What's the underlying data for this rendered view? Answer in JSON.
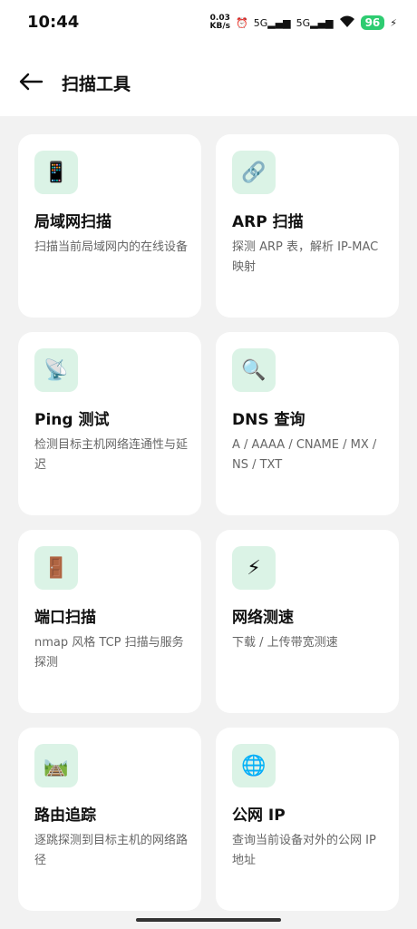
{
  "status_bar": {
    "time": "10:44",
    "net_speed_value": "0.03",
    "net_speed_unit": "KB/s",
    "signal_1": "5G",
    "signal_2": "5G",
    "battery": "96"
  },
  "app_bar": {
    "title": "扫描工具"
  },
  "tools": [
    {
      "icon": "📱",
      "title": "局域网扫描",
      "desc": "扫描当前局域网内的在线设备"
    },
    {
      "icon": "🔗",
      "title": "ARP 扫描",
      "desc": "探测 ARP 表，解析 IP-MAC 映射"
    },
    {
      "icon": "📡",
      "title": "Ping 测试",
      "desc": "检测目标主机网络连通性与延迟"
    },
    {
      "icon": "🔍",
      "title": "DNS 查询",
      "desc": "A / AAAA / CNAME / MX / NS / TXT"
    },
    {
      "icon": "🚪",
      "title": "端口扫描",
      "desc": "nmap 风格 TCP 扫描与服务探测"
    },
    {
      "icon": "⚡",
      "title": "网络测速",
      "desc": "下载 / 上传带宽测速"
    },
    {
      "icon": "🛤️",
      "title": "路由追踪",
      "desc": "逐跳探测到目标主机的网络路径"
    },
    {
      "icon": "🌐",
      "title": "公网 IP",
      "desc": "查询当前设备对外的公网 IP 地址"
    }
  ]
}
